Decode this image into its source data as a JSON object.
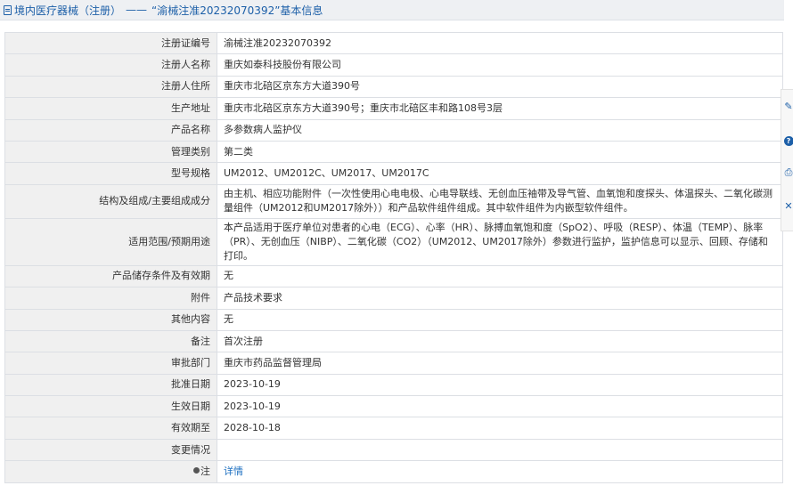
{
  "header": {
    "prefix": "境内医疗器械（注册）",
    "separator": "——",
    "title": "“渝械注准20232070392”基本信息"
  },
  "rows": [
    {
      "label": "注册证编号",
      "value": "渝械注准20232070392"
    },
    {
      "label": "注册人名称",
      "value": "重庆如泰科技股份有限公司"
    },
    {
      "label": "注册人住所",
      "value": "重庆市北碚区京东方大道390号"
    },
    {
      "label": "生产地址",
      "value": "重庆市北碚区京东方大道390号；重庆市北碚区丰和路108号3层"
    },
    {
      "label": "产品名称",
      "value": "多参数病人监护仪"
    },
    {
      "label": "管理类别",
      "value": "第二类"
    },
    {
      "label": "型号规格",
      "value": "UM2012、UM2012C、UM2017、UM2017C"
    },
    {
      "label": "结构及组成/主要组成成分",
      "value": "由主机、相应功能附件（一次性使用心电电极、心电导联线、无创血压袖带及导气管、血氧饱和度探头、体温探头、二氧化碳测量组件（UM2012和UM2017除外））和产品软件组件组成。其中软件组件为内嵌型软件组件。"
    },
    {
      "label": "适用范围/预期用途",
      "value": "本产品适用于医疗单位对患者的心电（ECG）、心率（HR）、脉搏血氧饱和度（SpO2）、呼吸（RESP）、体温（TEMP）、脉率（PR）、无创血压（NIBP）、二氧化碳（CO2）（UM2012、UM2017除外）参数进行监护，监护信息可以显示、回顾、存储和打印。"
    },
    {
      "label": "产品储存条件及有效期",
      "value": "无"
    },
    {
      "label": "附件",
      "value": "产品技术要求"
    },
    {
      "label": "其他内容",
      "value": "无"
    },
    {
      "label": "备注",
      "value": "首次注册"
    },
    {
      "label": "审批部门",
      "value": "重庆市药品监督管理局"
    },
    {
      "label": "批准日期",
      "value": "2023-10-19"
    },
    {
      "label": "生效日期",
      "value": "2023-10-19"
    },
    {
      "label": "有效期至",
      "value": "2028-10-18"
    },
    {
      "label": "变更情况",
      "value": ""
    }
  ],
  "note_row": {
    "label": "注",
    "link_text": "详情"
  },
  "toolbar": {
    "icons": [
      "edit-icon",
      "help-icon",
      "print-icon",
      "close-icon"
    ],
    "glyphs": [
      "✎",
      "?",
      "⎙",
      "✕"
    ]
  }
}
